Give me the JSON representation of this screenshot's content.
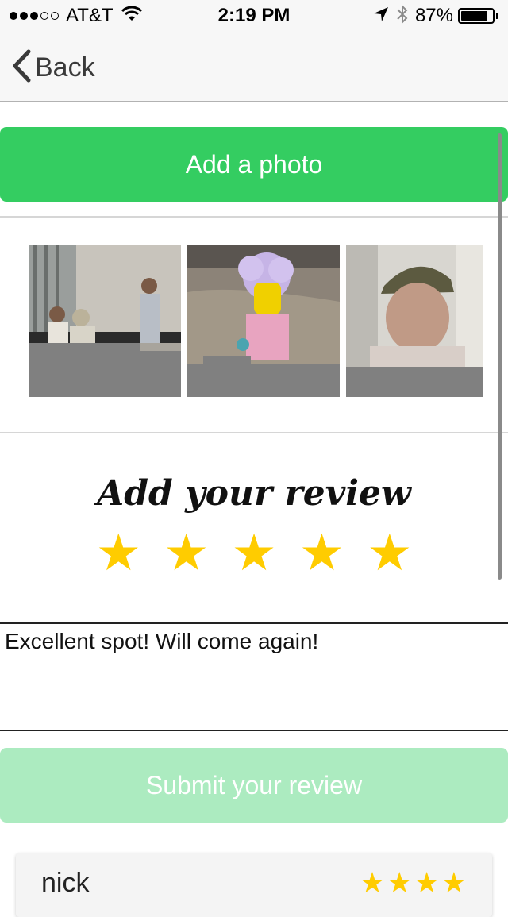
{
  "status_bar": {
    "carrier": "AT&T",
    "time": "2:19 PM",
    "battery_percent": "87%",
    "battery_level": 0.87,
    "signal_bars_filled": 3,
    "signal_bars_total": 5,
    "icons": [
      "signal-dots-icon",
      "wifi-icon",
      "location-arrow-icon",
      "bluetooth-icon",
      "battery-icon"
    ]
  },
  "nav": {
    "back_label": "Back",
    "back_icon": "chevron-left-icon"
  },
  "add_photo_label": "Add a photo",
  "photos": [
    "photo-people-meeting",
    "photo-lego-figure",
    "photo-man-cap"
  ],
  "review": {
    "title": "Add your review",
    "rating": 5,
    "max_rating": 5,
    "text": "Excellent spot! Will come again!"
  },
  "submit_label": "Submit your review",
  "reviews": [
    {
      "name": "nick",
      "stars": "★★★★",
      "rating": 4
    }
  ],
  "colors": {
    "accent_green": "#34cd61",
    "disabled_green": "#acebc0",
    "star_yellow": "#ffcc00"
  }
}
